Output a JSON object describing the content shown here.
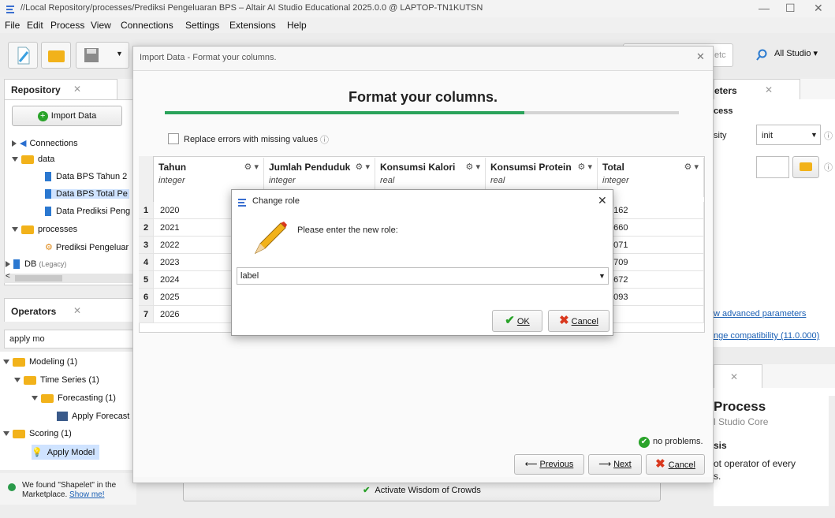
{
  "window": {
    "title": "//Local Repository/processes/Prediksi Pengeluaran BPS – Altair AI Studio Educational 2025.0.0 @ LAPTOP-TN1KUTSN",
    "minimize": "—",
    "maximize": "☐",
    "close": "✕"
  },
  "menu": [
    "File",
    "Edit",
    "Process",
    "View",
    "Connections",
    "Settings",
    "Extensions",
    "Help"
  ],
  "toolbar": {
    "search_hint": "etc",
    "studio_dropdown": "All Studio ▾"
  },
  "repository": {
    "tab": "Repository",
    "import_button": "Import Data",
    "items": [
      {
        "label": "Connections"
      },
      {
        "label": "data"
      },
      {
        "label": "Data BPS Tahun 2"
      },
      {
        "label": "Data BPS Total Pe"
      },
      {
        "label": "Data Prediksi Peng"
      },
      {
        "label": "processes"
      },
      {
        "label": "Prediksi Pengeluar"
      },
      {
        "label": "DB",
        "suffix": "(Legacy)"
      }
    ]
  },
  "operators": {
    "tab": "Operators",
    "search_value": "apply mo",
    "items": [
      {
        "label": "Modeling (1)"
      },
      {
        "label": "Time Series (1)"
      },
      {
        "label": "Forecasting (1)"
      },
      {
        "label": "Apply Forecast"
      },
      {
        "label": "Scoring (1)"
      },
      {
        "label": "Apply Model"
      }
    ],
    "marketplace_text": "We found \"Shapelet\" in the Marketplace.",
    "marketplace_link": "Show me!"
  },
  "parameters": {
    "tab": "eters",
    "section": "cess",
    "row_label": "sity",
    "select_value": "init",
    "advanced_link": "w advanced parameters",
    "compat_link": "nge compatibility (11.0.000)"
  },
  "help": {
    "title": "Process",
    "subtitle": "l Studio Core",
    "section": "sis",
    "text": "ot operator of every",
    "text2": "s."
  },
  "bottom_bar": {
    "wisdom": "Activate Wisdom of Crowds"
  },
  "import_dialog": {
    "title": "Import Data - Format your columns.",
    "heading": "Format your columns.",
    "progress": 0.7,
    "replace_errors_label": "Replace errors with missing values",
    "info_icon": "ⓘ",
    "columns": [
      {
        "name": "Tahun",
        "type": "integer"
      },
      {
        "name": "Jumlah Penduduk",
        "type": "integer"
      },
      {
        "name": "Konsumsi Kalori",
        "type": "real"
      },
      {
        "name": "Konsumsi Protein",
        "type": "real"
      },
      {
        "name": "Total",
        "type": "integer"
      }
    ],
    "rows": [
      {
        "idx": "1",
        "tahun": "2020",
        "total": "0162"
      },
      {
        "idx": "2",
        "tahun": "2021",
        "total": "3660"
      },
      {
        "idx": "3",
        "tahun": "2022",
        "total": "0071"
      },
      {
        "idx": "4",
        "tahun": "2023",
        "total": "3709"
      },
      {
        "idx": "5",
        "tahun": "2024",
        "total": "3672"
      },
      {
        "idx": "6",
        "tahun": "2025",
        "total": "5093"
      },
      {
        "idx": "7",
        "tahun": "2026",
        "total": ""
      }
    ],
    "status": "no problems.",
    "previous": "Previous",
    "next": "Next",
    "cancel": "Cancel"
  },
  "change_role": {
    "title": "Change role",
    "prompt": "Please enter the new role:",
    "value": "label",
    "ok": "OK",
    "cancel": "Cancel"
  }
}
